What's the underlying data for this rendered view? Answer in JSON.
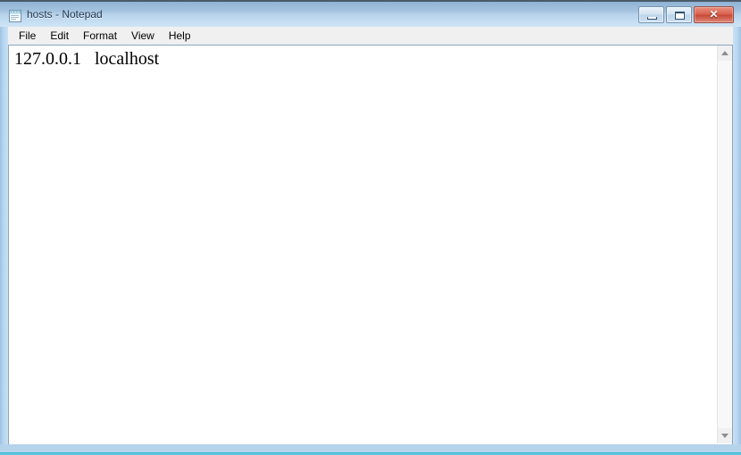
{
  "window": {
    "title": "hosts - Notepad",
    "icon": "notepad-icon",
    "frame_color": "#b9d6ee",
    "titlebar_accent": "#a6c4e0"
  },
  "titlebar_buttons": {
    "minimize": {
      "label": "",
      "icon": "minimize-icon"
    },
    "maximize": {
      "label": "",
      "icon": "maximize-icon"
    },
    "close": {
      "label": "✕",
      "icon": "close-icon",
      "color": "#c64734"
    }
  },
  "menubar": {
    "items": [
      {
        "label": "File"
      },
      {
        "label": "Edit"
      },
      {
        "label": "Format"
      },
      {
        "label": "View"
      },
      {
        "label": "Help"
      }
    ]
  },
  "document": {
    "lines": [
      "127.0.0.1   localhost"
    ]
  },
  "scrollbar": {
    "up_arrow": "scroll-up-icon",
    "down_arrow": "scroll-down-icon"
  }
}
